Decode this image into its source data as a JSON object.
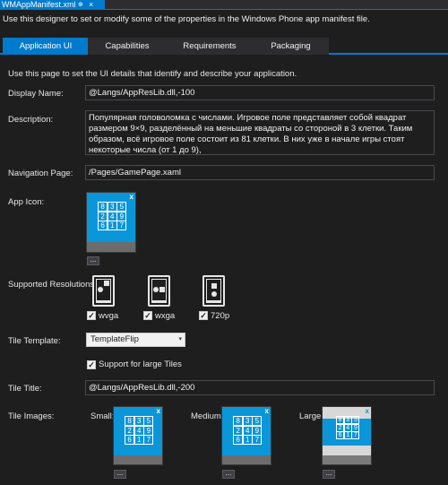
{
  "document_tab": {
    "title": "WMAppManifest.xml",
    "pin": "⊕",
    "close": "×"
  },
  "header": {
    "text": "Use this designer to set or modify some of the properties in the Windows Phone app manifest file."
  },
  "tabs": [
    {
      "label": "Application UI",
      "active": true
    },
    {
      "label": "Capabilities",
      "active": false
    },
    {
      "label": "Requirements",
      "active": false
    },
    {
      "label": "Packaging",
      "active": false
    }
  ],
  "intro": "Use this page to set the UI details that identify and describe your application.",
  "display_name": {
    "label": "Display Name:",
    "value": "@Langs/AppResLib.dll,-100"
  },
  "description": {
    "label": "Description:",
    "value": "Популярная головоломка с числами. Игровое поле представляет собой квадрат размером 9×9, разделённый на меньшие квадраты со стороной в 3 клетки. Таким образом, всё игровое поле состоит из 81 клетки. В них уже в начале игры стоят некоторые числа (от 1 до 9),"
  },
  "navigation_page": {
    "label": "Navigation Page:",
    "value": "/Pages/GamePage.xaml"
  },
  "app_icon": {
    "label": "App Icon:",
    "browse": "...",
    "close": "x"
  },
  "grid_digits": [
    "8",
    "3",
    "5",
    "2",
    "4",
    "9",
    "6",
    "1",
    "7"
  ],
  "supported_resolutions": {
    "label": "Supported Resolutions:",
    "items": [
      {
        "name": "wvga",
        "checked": true
      },
      {
        "name": "wxga",
        "checked": true
      },
      {
        "name": "720p",
        "checked": true
      }
    ]
  },
  "tile_template": {
    "label": "Tile Template:",
    "value": "TemplateFlip",
    "arrow": "▾"
  },
  "large_tiles": {
    "label": "Support for large Tiles",
    "checked": true
  },
  "tile_title": {
    "label": "Tile Title:",
    "value": "@Langs/AppResLib.dll,-200"
  },
  "tile_images": {
    "label": "Tile Images:",
    "small": "Small:",
    "medium": "Medium:",
    "large": "Large:",
    "browse": "...",
    "close": "x"
  },
  "check_mark": "✓",
  "colors": {
    "accent": "#007acc",
    "tile": "#0a96d8",
    "background": "#1e1e1e"
  }
}
